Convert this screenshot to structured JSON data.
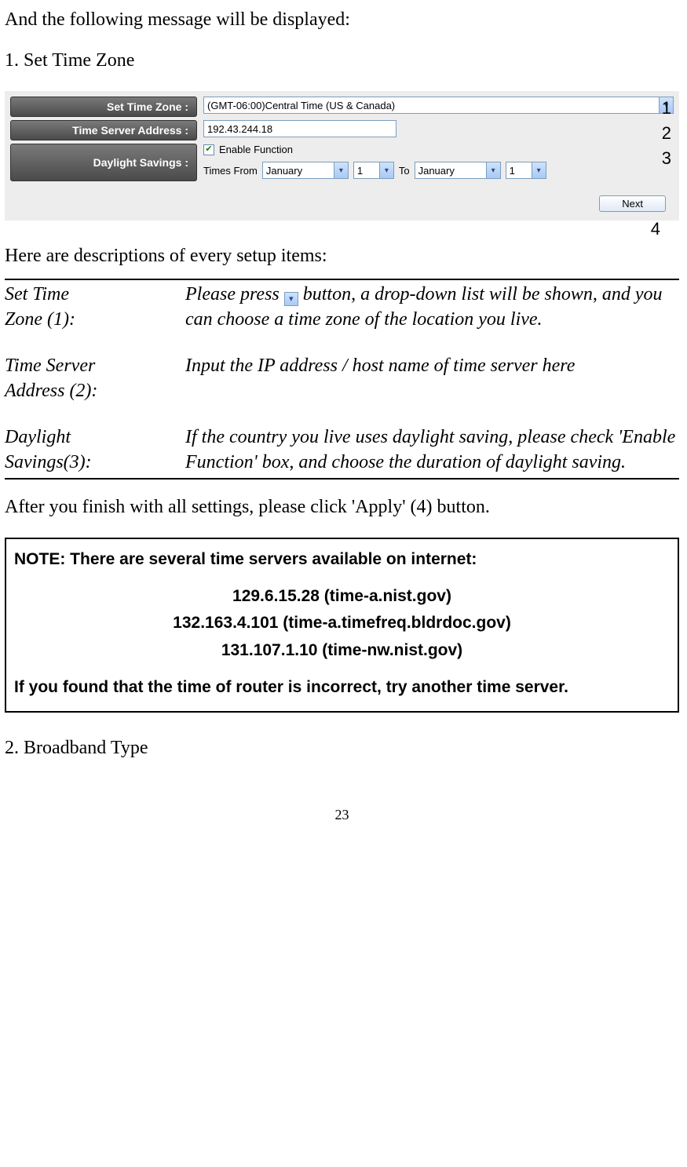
{
  "intro": "And the following message will be displayed:",
  "section1_heading": "1. Set Time Zone",
  "form": {
    "labels": {
      "setTimeZone": "Set Time Zone :",
      "timeServer": "Time Server Address :",
      "daylight": "Daylight Savings :"
    },
    "timezone_value": "(GMT-06:00)Central Time (US & Canada)",
    "timeserver_value": "192.43.244.18",
    "enable_label": "Enable Function",
    "times_from": "Times From",
    "to_label": "To",
    "month_from": "January",
    "day_from": "1",
    "month_to": "January",
    "day_to": "1",
    "next_label": "Next"
  },
  "callouts": {
    "c1": "1",
    "c2": "2",
    "c3": "3",
    "c4": "4"
  },
  "desc_intro": "Here are descriptions of every setup items:",
  "desc": {
    "r1a": "Set Time\nZone (1):",
    "r1b_before": "Please press ",
    "r1b_after": " button, a drop-down list will be shown, and you can choose a time zone of the location you live.",
    "r2a": "Time Server\nAddress (2):",
    "r2b": "Input the IP address / host name of time server here",
    "r3a": "Daylight\nSavings(3):",
    "r3b": "If the country you live uses daylight saving, please check 'Enable Function' box, and choose the duration of daylight saving."
  },
  "after_text": "After you finish with all settings, please click 'Apply' (4) button.",
  "note": {
    "heading": "NOTE: There are several time servers available on internet:",
    "servers": [
      "129.6.15.28 (time-a.nist.gov)",
      "132.163.4.101 (time-a.timefreq.bldrdoc.gov)",
      "131.107.1.10 (time-nw.nist.gov)"
    ],
    "footer": "If you found that the time of router is incorrect, try another time server."
  },
  "section2_heading": "2. Broadband Type",
  "page_number": "23"
}
